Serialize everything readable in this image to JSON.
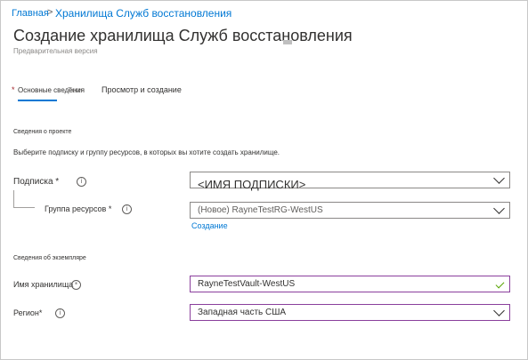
{
  "breadcrumb": {
    "home": "Главная",
    "separator": ">",
    "current": "Хранилища Служб восстановления"
  },
  "page": {
    "title": "Создание хранилища Служб восстановления",
    "subtitle": "Предварительная версия"
  },
  "tabs": {
    "basics": {
      "required_mark": "*",
      "label": "Основные сведения"
    },
    "overlap_text": "Теги",
    "review": "Просмотр и создание"
  },
  "project": {
    "heading": "Сведения о проекте",
    "description": "Выберите подписку и группу ресурсов, в которых вы хотите создать хранилище.",
    "subscription": {
      "label": "Подписка *",
      "value": "<ИМЯ ПОДПИСКИ>"
    },
    "resource_group": {
      "label": "Группа ресурсов *",
      "value": "(Новое) RayneTestRG-WestUS",
      "create_link": "Создание"
    }
  },
  "instance": {
    "heading": "Сведения об экземпляре",
    "vault_name": {
      "label": "Имя хранилища",
      "required_mark": "*",
      "value": "RayneTestVault-WestUS"
    },
    "region": {
      "label": "Регион*",
      "value": "Западная часть США"
    }
  },
  "colors": {
    "link": "#0078d4",
    "validated_border": "#8a3f9c",
    "check": "#57a300",
    "required": "#a4262c"
  },
  "icons": [
    "info-icon",
    "chevron-down-icon",
    "checkmark-icon"
  ]
}
